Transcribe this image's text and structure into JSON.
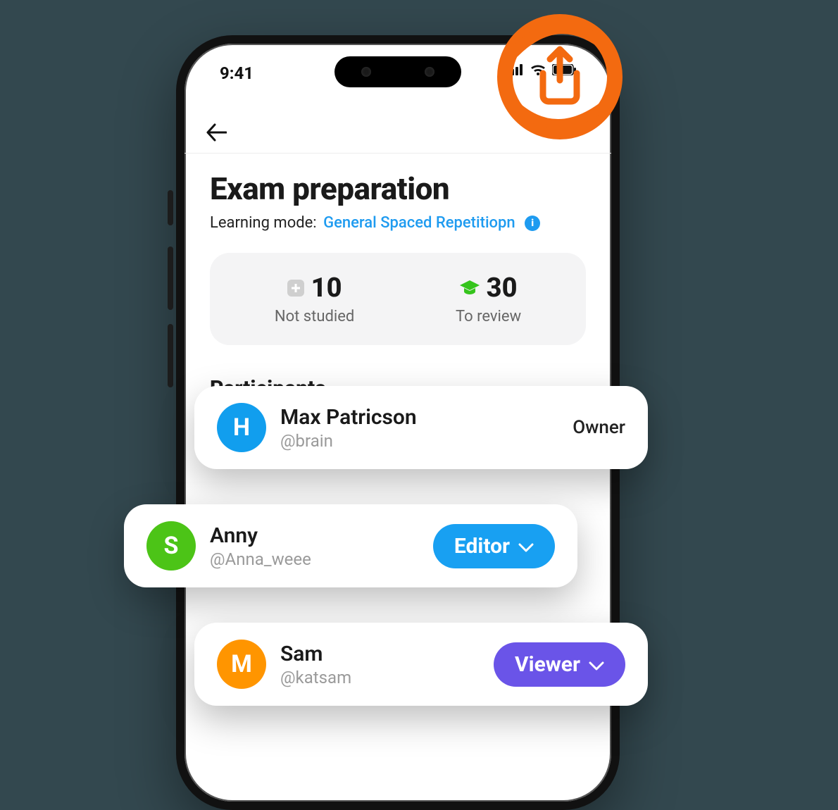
{
  "status": {
    "time": "9:41"
  },
  "header": {
    "title": "Exam preparation",
    "mode_label": "Learning mode:",
    "mode_value": "General Spaced Repetitiopn"
  },
  "stats": {
    "not_studied": {
      "value": "10",
      "label": "Not studied"
    },
    "to_review": {
      "value": "30",
      "label": "To review"
    }
  },
  "sections": {
    "participants_title": "Participants"
  },
  "participants": [
    {
      "avatar_letter": "H",
      "name": "Max Patricson",
      "handle": "@brain",
      "role": "Owner",
      "role_type": "static"
    },
    {
      "avatar_letter": "S",
      "name": "Anny",
      "handle": "@Anna_weee",
      "role": "Editor",
      "role_type": "pill"
    },
    {
      "avatar_letter": "M",
      "name": "Sam",
      "handle": "@katsam",
      "role": "Viewer",
      "role_type": "pill"
    }
  ]
}
